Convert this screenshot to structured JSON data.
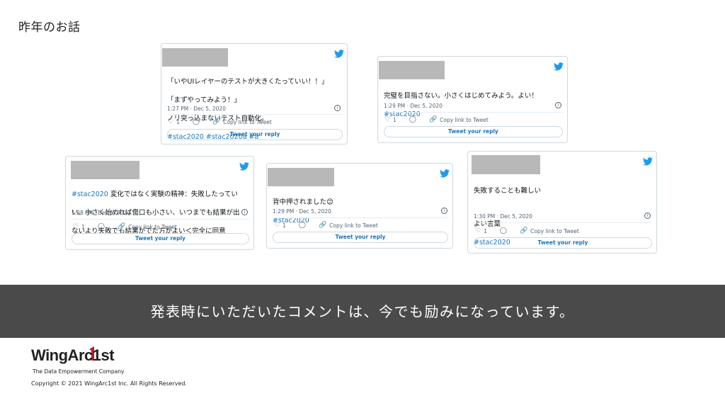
{
  "slide": {
    "title": "昨年のお話"
  },
  "tweets": [
    {
      "lines": [
        "「いやUIレイヤーのテストが大きくたっていい！！」",
        "「まずやってみよう！」",
        "ノリ突っ込まないテスト自動化。"
      ],
      "tags": "#stac2020 #stac2020a #a",
      "timestamp": "1:27 PM · Dec 5, 2020",
      "likes": "1",
      "copy_link": "Copy link to Tweet",
      "reply": "Tweet your reply"
    },
    {
      "lines": [
        "完璧を目指さない。小さくはじめてみよう。よい！"
      ],
      "tags": "#stac2020",
      "timestamp": "1:29 PM · Dec 5, 2020",
      "likes": "1",
      "copy_link": "Copy link to Tweet",
      "reply": "Tweet your reply"
    },
    {
      "first_tag": "#stac2020",
      "lines": [
        " 変化ではなく実験の精神：失敗したってい",
        "い、小さく始めれば傷口も小さい、いつまでも結果が出",
        "ないより失敗でも結果がでた方がよい＜完全に同意"
      ],
      "timestamp": "1:28 PM · Dec 5, 2020",
      "likes": "1",
      "copy_link": "Copy link to Tweet",
      "reply": "Tweet your reply"
    },
    {
      "lines": [
        "背中押されました😊"
      ],
      "tags": "#stac2020",
      "timestamp": "1:29 PM · Dec 5, 2020",
      "likes": "1",
      "copy_link": "Copy link to Tweet",
      "reply": "Tweet your reply"
    },
    {
      "lines": [
        "失敗することも難しい",
        "",
        "よい言葉"
      ],
      "tags": "#stac2020",
      "timestamp": "1:30 PM · Dec 5, 2020",
      "likes": "1",
      "copy_link": "Copy link to Tweet",
      "reply": "Tweet your reply"
    }
  ],
  "banner": {
    "text": "発表時にいただいたコメントは、今でも励みになっています。"
  },
  "footer": {
    "logo_name": "WingArc1st",
    "tagline": "The Data Empowerment Company",
    "copyright": "Copyright © 2021 WingArc1st Inc.  All Rights Reserved."
  },
  "colors": {
    "hashtag": "#1b75bb",
    "twitter_bird": "#1d9bf0",
    "banner_bg": "#4a4a4a",
    "logo_red": "#c8161d"
  }
}
